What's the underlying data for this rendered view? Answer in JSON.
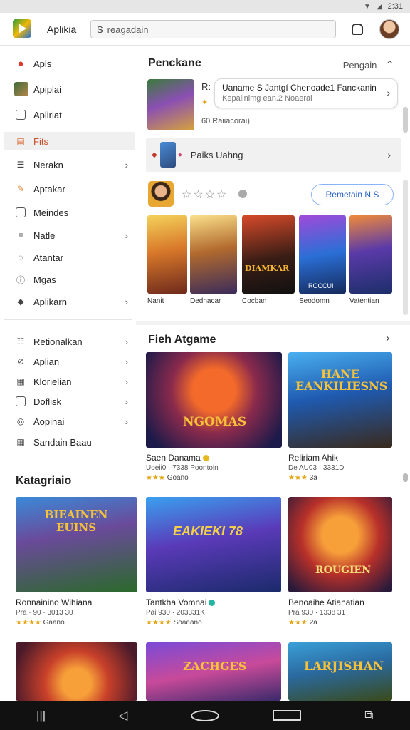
{
  "status_bar": {
    "time": "2:31",
    "icons": [
      "wifi-icon",
      "signal-icon"
    ]
  },
  "header": {
    "title": "Aplikia",
    "search": {
      "value": "",
      "placeholder": "reagadain"
    }
  },
  "sidebar": {
    "items": [
      {
        "label": "Apls",
        "icon": "apps-icon",
        "chevron": false,
        "active": false
      },
      {
        "label": "Apiplai",
        "icon": "game-thumb-icon",
        "chevron": false,
        "active": false
      },
      {
        "label": "Apliriat",
        "icon": "square-icon",
        "chevron": false,
        "active": false
      },
      {
        "label": "Fits",
        "icon": "card-icon",
        "chevron": false,
        "active": true
      },
      {
        "label": "Nerakn",
        "icon": "list-icon",
        "chevron": true,
        "active": false
      },
      {
        "label": "Aptakar",
        "icon": "leaf-icon",
        "chevron": false,
        "active": false
      },
      {
        "label": "Meindes",
        "icon": "square-icon",
        "chevron": false,
        "active": false
      },
      {
        "label": "Natle",
        "icon": "menu-icon",
        "chevron": true,
        "active": false
      },
      {
        "label": "Atantar",
        "icon": "chat-icon",
        "chevron": false,
        "active": false
      },
      {
        "label": "Mgas",
        "icon": "info-icon",
        "chevron": false,
        "active": false
      },
      {
        "label": "Aplikarn",
        "icon": "tag-icon",
        "chevron": true,
        "active": false
      }
    ],
    "items2": [
      {
        "label": "Retionalkan",
        "icon": "list-icon",
        "chevron": true
      },
      {
        "label": "Aplian",
        "icon": "share-icon",
        "chevron": true
      },
      {
        "label": "Klorielian",
        "icon": "grid-icon",
        "chevron": true
      },
      {
        "label": "Doflisk",
        "icon": "square-icon",
        "chevron": true
      },
      {
        "label": "Aopinai",
        "icon": "target-icon",
        "chevron": true
      },
      {
        "label": "Sandain Baau",
        "icon": "apps-grid-icon",
        "chevron": false
      }
    ]
  },
  "panel": {
    "title": "Penckane",
    "right_label": "Pengain",
    "feature": {
      "icon_text": "R:",
      "tooltip_line1": "Uaname S Jantgí Chenoade1 Fanckanin",
      "tooltip_line2": "Kepaiinimg ean.2 Noaerai",
      "sub": "60  Raiiacorai)"
    },
    "row": {
      "label": "Paiks Uahng"
    },
    "app": {
      "stars": "☆☆☆☆",
      "button": "Remetain N S"
    },
    "heroes": [
      "Nanit",
      "Dedhacar",
      "Cocban",
      "Seodomn",
      "Vatentian"
    ]
  },
  "featured": {
    "title": "Fieh Atgame",
    "cards": [
      {
        "name": "Saen Danama",
        "meta": "Uoeii0 · 7338 Poontoin",
        "rating": "Goano",
        "badge_color": "#e8b820"
      },
      {
        "name": "Reliriam Ahik",
        "meta": "De AU03 · 3331D",
        "rating": "3a",
        "badge_color": ""
      }
    ]
  },
  "categories": {
    "title": "Katagriaio",
    "cards": [
      {
        "name": "Ronnainino Wihiana",
        "meta": "Pra · 90 · 3013 30",
        "rating": "Gaano",
        "badge_color": ""
      },
      {
        "name": "Tantkha Vomnai",
        "meta": "Pai 930 · 203331K",
        "rating": "Soaeano",
        "badge_color": "#26b5a0"
      },
      {
        "name": "Benoaihe Atiahatian",
        "meta": "Pra 930 · 1338 31",
        "rating": "2a",
        "badge_color": ""
      }
    ]
  },
  "art_text": {
    "feature_thumb": "",
    "hero4": "ROCCUI",
    "hero3": "DIAMKAR",
    "feat1": "NGOMAS",
    "feat2": "HANE EANKILIESNS",
    "cat1": "BIEAINEN EUINS",
    "cat2": "EAKIEKI 78",
    "cat3": "ROUGIEN",
    "bot2": "ZACHGES",
    "bot3": "LARJISHAN"
  },
  "navbar": {
    "buttons": [
      "recents-icon",
      "back-icon",
      "home-icon",
      "overview-icon",
      "screenshot-icon"
    ]
  }
}
